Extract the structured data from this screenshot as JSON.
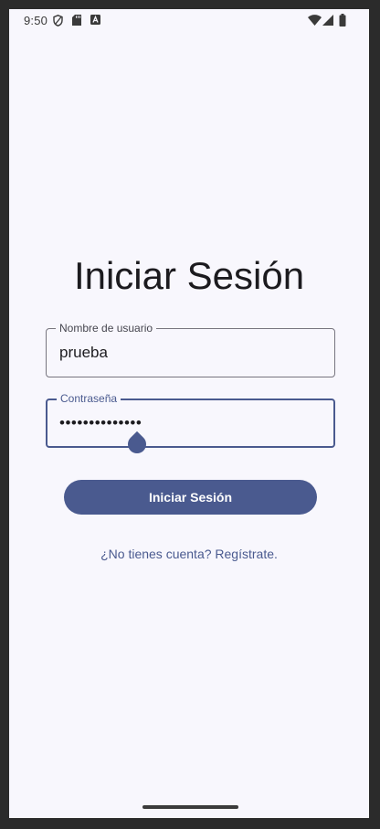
{
  "status_bar": {
    "time": "9:50",
    "left_icons": [
      "shield-icon",
      "sd-card-icon",
      "a-badge-icon"
    ],
    "right_icons": [
      "wifi-icon",
      "signal-icon",
      "battery-icon"
    ]
  },
  "login": {
    "title": "Iniciar Sesión",
    "username_label": "Nombre de usuario",
    "username_value": "prueba",
    "password_label": "Contraseña",
    "password_value": "••••••••••••••",
    "submit_label": "Iniciar Sesión",
    "register_link": "¿No tienes cuenta? Regístrate."
  },
  "colors": {
    "primary": "#4a5a8f",
    "background": "#f8f7fd",
    "outline": "#77757f",
    "text": "#1c1b1f"
  }
}
